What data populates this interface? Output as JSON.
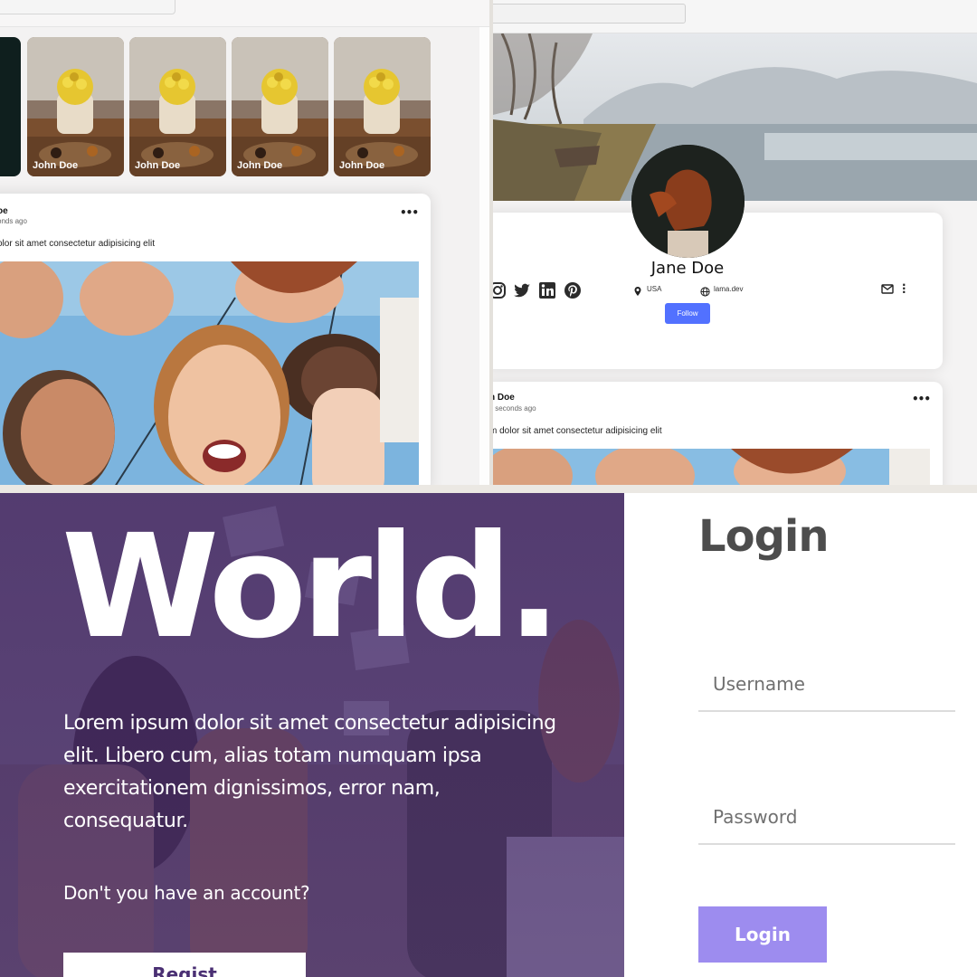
{
  "feed": {
    "stories": [
      {
        "name": "John Doe"
      },
      {
        "name": "John Doe"
      },
      {
        "name": "John Doe"
      },
      {
        "name": "John Doe"
      }
    ],
    "post": {
      "user_name": "oe",
      "time": "onds ago",
      "text": "olor sit amet consectetur adipisicing elit",
      "menu_icon": "more-horizontal-icon"
    }
  },
  "profile": {
    "name": "Jane Doe",
    "location": "USA",
    "website": "lama.dev",
    "follow_label": "Follow",
    "social_icons": [
      "instagram-icon",
      "twitter-icon",
      "linkedin-icon",
      "pinterest-icon"
    ],
    "post": {
      "user_name": "n Doe",
      "time": "v seconds ago",
      "text": "m dolor sit amet consectetur adipisicing elit"
    },
    "accent": "#5271ff"
  },
  "register": {
    "headline": "World.",
    "description": "Lorem ipsum dolor sit amet consectetur adipisicing elit. Libero cum, alias totam numquam ipsa exercitationem dignissimos, error nam, consequatur.",
    "question": "Don't you have an account?",
    "button_label": "Regist",
    "overlay_color": "#3f2466"
  },
  "login": {
    "title": "Login",
    "username_placeholder": "Username",
    "password_placeholder": "Password",
    "button_label": "Login",
    "button_color": "#9d8cef"
  }
}
